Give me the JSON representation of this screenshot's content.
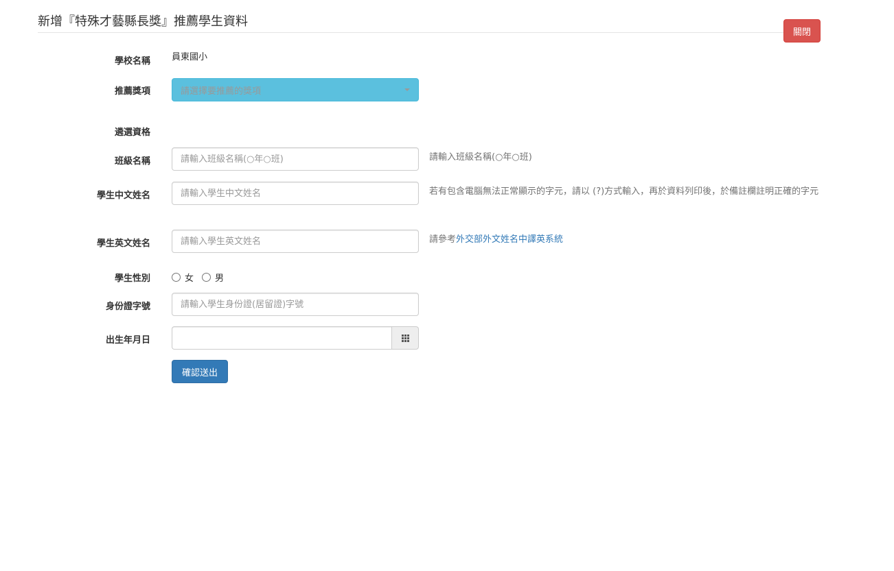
{
  "header": {
    "title": "新增『特殊才藝縣長獎』推薦學生資料",
    "close_label": "關閉"
  },
  "form": {
    "school": {
      "label": "學校名稱",
      "value": "員東國小"
    },
    "award": {
      "label": "推薦獎項",
      "placeholder": "請選擇要推薦的獎項"
    },
    "eligibility": {
      "label": "遴選資格"
    },
    "class_name": {
      "label": "班級名稱",
      "placeholder": "請輸入班級名稱(○年○班)",
      "help": "請輸入班級名稱(○年○班)"
    },
    "chinese_name": {
      "label": "學生中文姓名",
      "placeholder": "請輸入學生中文姓名",
      "help": "若有包含電腦無法正常顯示的字元，請以 (?)方式輸入，再於資料列印後，於備註欄註明正確的字元"
    },
    "english_name": {
      "label": "學生英文姓名",
      "placeholder": "請輸入學生英文姓名",
      "help_prefix": "請參考",
      "help_link": "外交部外文姓名中譯英系統"
    },
    "gender": {
      "label": "學生性別",
      "options": [
        "女",
        "男"
      ]
    },
    "id_number": {
      "label": "身份證字號",
      "placeholder": "請輸入學生身份證(居留證)字號"
    },
    "birthday": {
      "label": "出生年月日",
      "value": ""
    },
    "submit_label": "確認送出"
  },
  "colors": {
    "close_button": "#d9534f",
    "select_bg": "#5bc0de",
    "submit_button": "#337ab7",
    "link": "#337ab7"
  }
}
